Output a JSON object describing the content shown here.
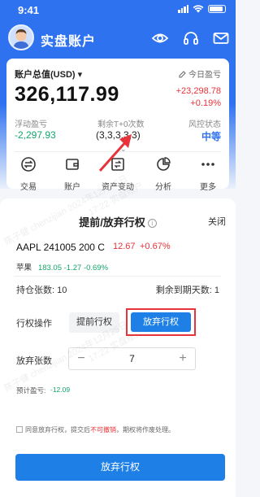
{
  "status_bar": {
    "time": "9:41"
  },
  "header": {
    "title": "实盘账户",
    "icons": [
      "eye-icon",
      "headset-icon",
      "mail-icon"
    ]
  },
  "account": {
    "total_label": "账户总值(USD)",
    "total_value": "326,117.99",
    "today_label": "今日盈亏",
    "today_value": "+23,298.78",
    "today_pct": "+0.19%",
    "float_label": "浮动盈亏",
    "float_value": "-2,297.93",
    "tplus_label": "剩余T+0次数",
    "tplus_value": "(3,3,3,3,3)",
    "risk_label": "风控状态",
    "risk_value": "中等",
    "colors": {
      "up": "#e8333a",
      "down": "#12a66a",
      "accent": "#2f72f0"
    }
  },
  "quick_actions": [
    {
      "label": "交易",
      "icon": "trade-icon"
    },
    {
      "label": "账户",
      "icon": "wallet-icon"
    },
    {
      "label": "资产变动",
      "icon": "asset-change-icon"
    },
    {
      "label": "分析",
      "icon": "pie-chart-icon"
    },
    {
      "label": "更多",
      "icon": "more-icon"
    }
  ],
  "watermark": [
    "陈子健 chenzijian 2024年12月25日",
    "17:22 实盘账户"
  ],
  "sheet": {
    "title": "提前/放弃行权",
    "close_label": "关闭",
    "option_name": "AAPL 241005 200 C",
    "option_price": "12.67",
    "option_change_pct": "+0.67%",
    "underlying_name": "苹果",
    "underlying_price": "183.05",
    "underlying_change": "-1.27",
    "underlying_change_pct": "-0.69%",
    "holding_label": "持仓张数:",
    "holding_value": "10",
    "days_label": "剩余到期天数:",
    "days_value": "1",
    "action_label": "行权操作",
    "early_button": "提前行权",
    "abandon_button": "放弃行权",
    "qty_label": "放弃张数",
    "qty_value": "7",
    "est_label": "预计盈亏:",
    "est_value": "-12.09",
    "agree_text_1": "同意放弃行权，提交后",
    "agree_text_red": "不可撤销",
    "agree_text_2": "，期权将作废处理。",
    "submit_button": "放弃行权"
  }
}
